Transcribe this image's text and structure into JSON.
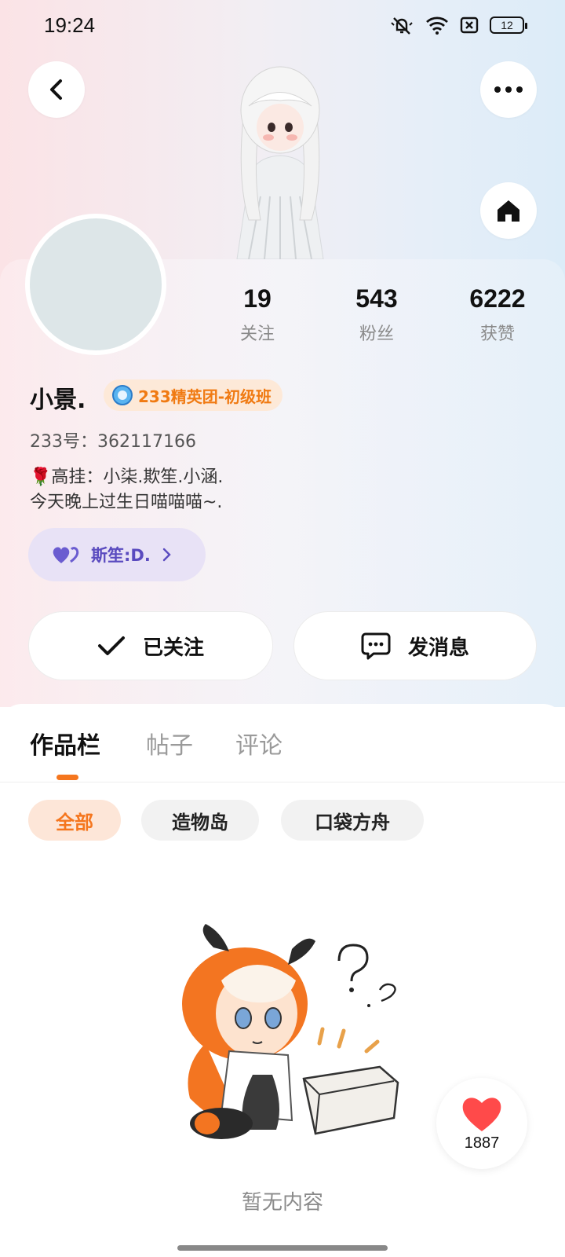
{
  "status_bar": {
    "time": "19:24",
    "battery": "12"
  },
  "profile": {
    "stats": [
      {
        "value": "19",
        "label": "关注"
      },
      {
        "value": "543",
        "label": "粉丝"
      },
      {
        "value": "6222",
        "label": "获赞"
      }
    ],
    "username": "小景.",
    "badge": "233精英团-初级班",
    "user_id": "233号：362117166",
    "bio_line1": "🌹高挂：小柒.欺笙.小涵.",
    "bio_line2": "今天晚上过生日喵喵喵~.",
    "cp_name": "斯笙:D."
  },
  "actions": {
    "follow_label": "已关注",
    "message_label": "发消息"
  },
  "tabs": [
    "作品栏",
    "帖子",
    "评论"
  ],
  "filters": [
    "全部",
    "造物岛",
    "口袋方舟"
  ],
  "empty_text": "暂无内容",
  "like_count": "1887",
  "colors": {
    "accent": "#f5761e",
    "badge_text": "#f07a12",
    "cp_purple": "#5a4bbf",
    "heart_red": "#ff4a4a"
  }
}
